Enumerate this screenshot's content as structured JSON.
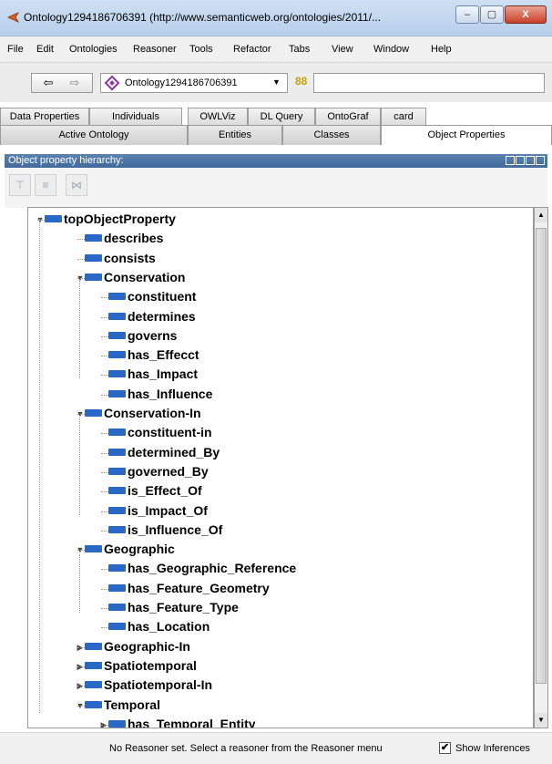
{
  "window": {
    "title": "Ontology1294186706391 (http://www.semanticweb.org/ontologies/2011/...",
    "min_label": "–",
    "max_label": "▢",
    "close_label": "X"
  },
  "menu": [
    "File",
    "Edit",
    "Ontologies",
    "Reasoner",
    "Tools",
    "Refactor",
    "Tabs",
    "View",
    "Window",
    "Help"
  ],
  "toolbar": {
    "back_icon": "⇦",
    "forward_icon": "⇨",
    "ontology_select": "Ontology1294186706391",
    "select_arrow": "▼",
    "search_icon": "88",
    "search_value": ""
  },
  "tabs_row1": [
    "Data Properties",
    "Individuals",
    "OWLViz",
    "DL Query",
    "OntoGraf",
    "card"
  ],
  "tabs_row2": [
    "Active Ontology",
    "Entities",
    "Classes",
    "Object Properties"
  ],
  "panel": {
    "title": "Object property hierarchy:",
    "tool_icons": [
      "add-sub-property-icon",
      "add-sibling-property-icon",
      "delete-property-icon"
    ]
  },
  "tree": [
    {
      "label": "topObjectProperty",
      "level": 0,
      "toggle": "expanded"
    },
    {
      "label": "describes",
      "level": 1,
      "toggle": "none"
    },
    {
      "label": "consists",
      "level": 1,
      "toggle": "none"
    },
    {
      "label": "Conservation",
      "level": 1,
      "toggle": "expanded"
    },
    {
      "label": "constituent",
      "level": 2,
      "toggle": "none"
    },
    {
      "label": "determines",
      "level": 2,
      "toggle": "none"
    },
    {
      "label": "governs",
      "level": 2,
      "toggle": "none"
    },
    {
      "label": "has_Effecct",
      "level": 2,
      "toggle": "none"
    },
    {
      "label": "has_Impact",
      "level": 2,
      "toggle": "none"
    },
    {
      "label": "has_Influence",
      "level": 2,
      "toggle": "none"
    },
    {
      "label": "Conservation-In",
      "level": 1,
      "toggle": "expanded"
    },
    {
      "label": "constituent-in",
      "level": 2,
      "toggle": "none"
    },
    {
      "label": "determined_By",
      "level": 2,
      "toggle": "none"
    },
    {
      "label": "governed_By",
      "level": 2,
      "toggle": "none"
    },
    {
      "label": "is_Effect_Of",
      "level": 2,
      "toggle": "none"
    },
    {
      "label": "is_Impact_Of",
      "level": 2,
      "toggle": "none"
    },
    {
      "label": "is_Influence_Of",
      "level": 2,
      "toggle": "none"
    },
    {
      "label": "Geographic",
      "level": 1,
      "toggle": "expanded"
    },
    {
      "label": "has_Geographic_Reference",
      "level": 2,
      "toggle": "none"
    },
    {
      "label": "has_Feature_Geometry",
      "level": 2,
      "toggle": "none"
    },
    {
      "label": "has_Feature_Type",
      "level": 2,
      "toggle": "none"
    },
    {
      "label": "has_Location",
      "level": 2,
      "toggle": "none"
    },
    {
      "label": "Geographic-In",
      "level": 1,
      "toggle": "collapsed"
    },
    {
      "label": "Spatiotemporal",
      "level": 1,
      "toggle": "collapsed"
    },
    {
      "label": "Spatiotemporal-In",
      "level": 1,
      "toggle": "collapsed"
    },
    {
      "label": "Temporal",
      "level": 1,
      "toggle": "expanded"
    },
    {
      "label": "has_Temporal_Entity",
      "level": 2,
      "toggle": "collapsed"
    }
  ],
  "status": {
    "message": "No Reasoner set. Select a reasoner from the Reasoner menu",
    "show_inferences_label": "Show Inferences",
    "show_inferences_checked": true
  },
  "colors": {
    "property_bar": "#2a68c8",
    "panel_header": "#41699a"
  }
}
